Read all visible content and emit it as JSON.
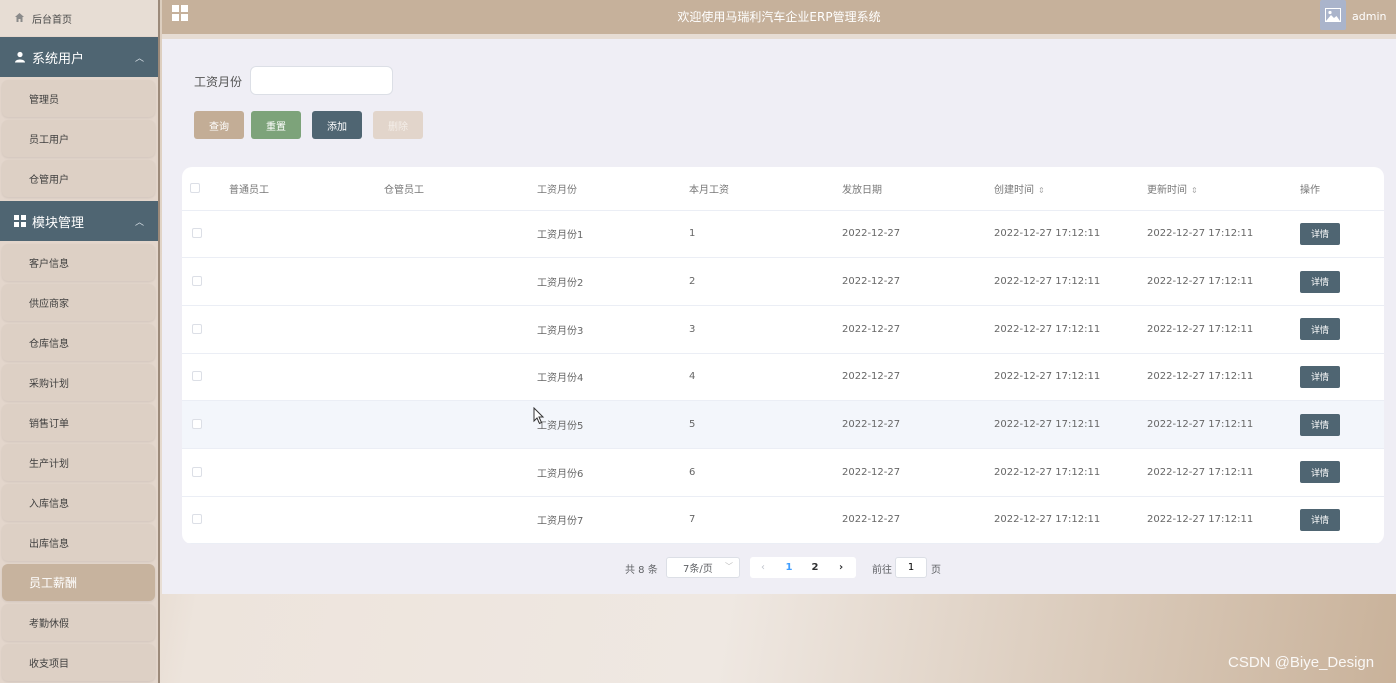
{
  "sidebar": {
    "home_label": "后台首页",
    "groups": [
      {
        "label": "系统用户",
        "icon": "user-icon",
        "items": [
          "管理员",
          "员工用户",
          "仓管用户"
        ]
      },
      {
        "label": "模块管理",
        "icon": "grid-icon",
        "items": [
          "客户信息",
          "供应商家",
          "仓库信息",
          "采购计划",
          "销售订单",
          "生产计划",
          "入库信息",
          "出库信息",
          "员工薪酬",
          "考勤休假",
          "收支项目"
        ]
      }
    ],
    "active_item": "员工薪酬"
  },
  "header": {
    "title": "欢迎使用马瑞利汽车企业ERP管理系统",
    "username": "admin"
  },
  "filter": {
    "label": "工资月份",
    "value": "",
    "buttons": {
      "query": "查询",
      "reset": "重置",
      "add": "添加",
      "delete": "删除"
    }
  },
  "table": {
    "columns": [
      "普通员工",
      "仓管员工",
      "工资月份",
      "本月工资",
      "发放日期",
      "创建时间",
      "更新时间",
      "操作"
    ],
    "detail_label": "详情",
    "rows": [
      {
        "employee": "",
        "warehouse_staff": "",
        "month": "工资月份1",
        "salary": "1",
        "pay_date": "2022-12-27",
        "created": "2022-12-27 17:12:11",
        "updated": "2022-12-27 17:12:11"
      },
      {
        "employee": "",
        "warehouse_staff": "",
        "month": "工资月份2",
        "salary": "2",
        "pay_date": "2022-12-27",
        "created": "2022-12-27 17:12:11",
        "updated": "2022-12-27 17:12:11"
      },
      {
        "employee": "",
        "warehouse_staff": "",
        "month": "工资月份3",
        "salary": "3",
        "pay_date": "2022-12-27",
        "created": "2022-12-27 17:12:11",
        "updated": "2022-12-27 17:12:11"
      },
      {
        "employee": "",
        "warehouse_staff": "",
        "month": "工资月份4",
        "salary": "4",
        "pay_date": "2022-12-27",
        "created": "2022-12-27 17:12:11",
        "updated": "2022-12-27 17:12:11"
      },
      {
        "employee": "",
        "warehouse_staff": "",
        "month": "工资月份5",
        "salary": "5",
        "pay_date": "2022-12-27",
        "created": "2022-12-27 17:12:11",
        "updated": "2022-12-27 17:12:11"
      },
      {
        "employee": "",
        "warehouse_staff": "",
        "month": "工资月份6",
        "salary": "6",
        "pay_date": "2022-12-27",
        "created": "2022-12-27 17:12:11",
        "updated": "2022-12-27 17:12:11"
      },
      {
        "employee": "",
        "warehouse_staff": "",
        "month": "工资月份7",
        "salary": "7",
        "pay_date": "2022-12-27",
        "created": "2022-12-27 17:12:11",
        "updated": "2022-12-27 17:12:11"
      }
    ]
  },
  "pagination": {
    "total_text": "共 8 条",
    "page_size": "7条/页",
    "pages": [
      "1",
      "2"
    ],
    "current_page": "1",
    "goto_label": "前往",
    "goto_value": "1",
    "page_unit": "页"
  },
  "watermark": "CSDN @Biye_Design",
  "colors": {
    "accent": "#c6b19b",
    "dark": "#4f6572",
    "reset": "#7da37a"
  }
}
